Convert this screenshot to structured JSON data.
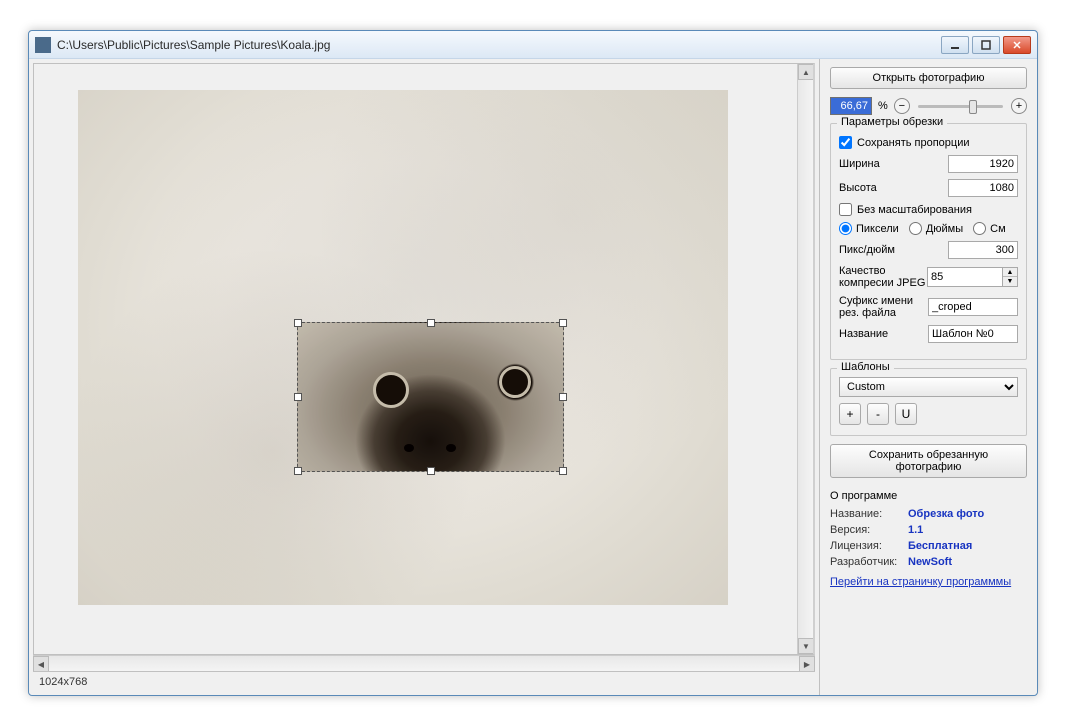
{
  "title": "C:\\Users\\Public\\Pictures\\Sample Pictures\\Koala.jpg",
  "status": {
    "dims": "1024x768"
  },
  "zoom": {
    "value": "66,67",
    "pct": "%"
  },
  "open_btn": "Открыть фотографию",
  "crop_params": {
    "group_title": "Параметры обрезки",
    "keep_aspect_label": "Сохранять пропорции",
    "width_label": "Ширина",
    "width_value": "1920",
    "height_label": "Высота",
    "height_value": "1080",
    "no_scale_label": "Без масштабирования",
    "units": {
      "px": "Пиксели",
      "in": "Дюймы",
      "cm": "См"
    },
    "dpi_label": "Пикс/дюйм",
    "dpi_value": "300",
    "jpeg_label": "Качество компресии JPEG",
    "jpeg_value": "85",
    "suffix_label": "Суфикс имени рез. файла",
    "suffix_value": "_croped",
    "name_label": "Название",
    "name_value": "Шаблон №0"
  },
  "templates": {
    "group_title": "Шаблоны",
    "selected": "Custom",
    "add": "+",
    "del": "-",
    "upd": "U"
  },
  "save_btn": "Сохранить обрезанную фотографию",
  "about": {
    "title": "О программе",
    "name_k": "Название:",
    "name_v": "Обрезка фото",
    "ver_k": "Версия:",
    "ver_v": "1.1",
    "lic_k": "Лицензия:",
    "lic_v": "Бесплатная",
    "dev_k": "Разработчик:",
    "dev_v": "NewSoft",
    "link": "Перейти на страничку программмы"
  }
}
